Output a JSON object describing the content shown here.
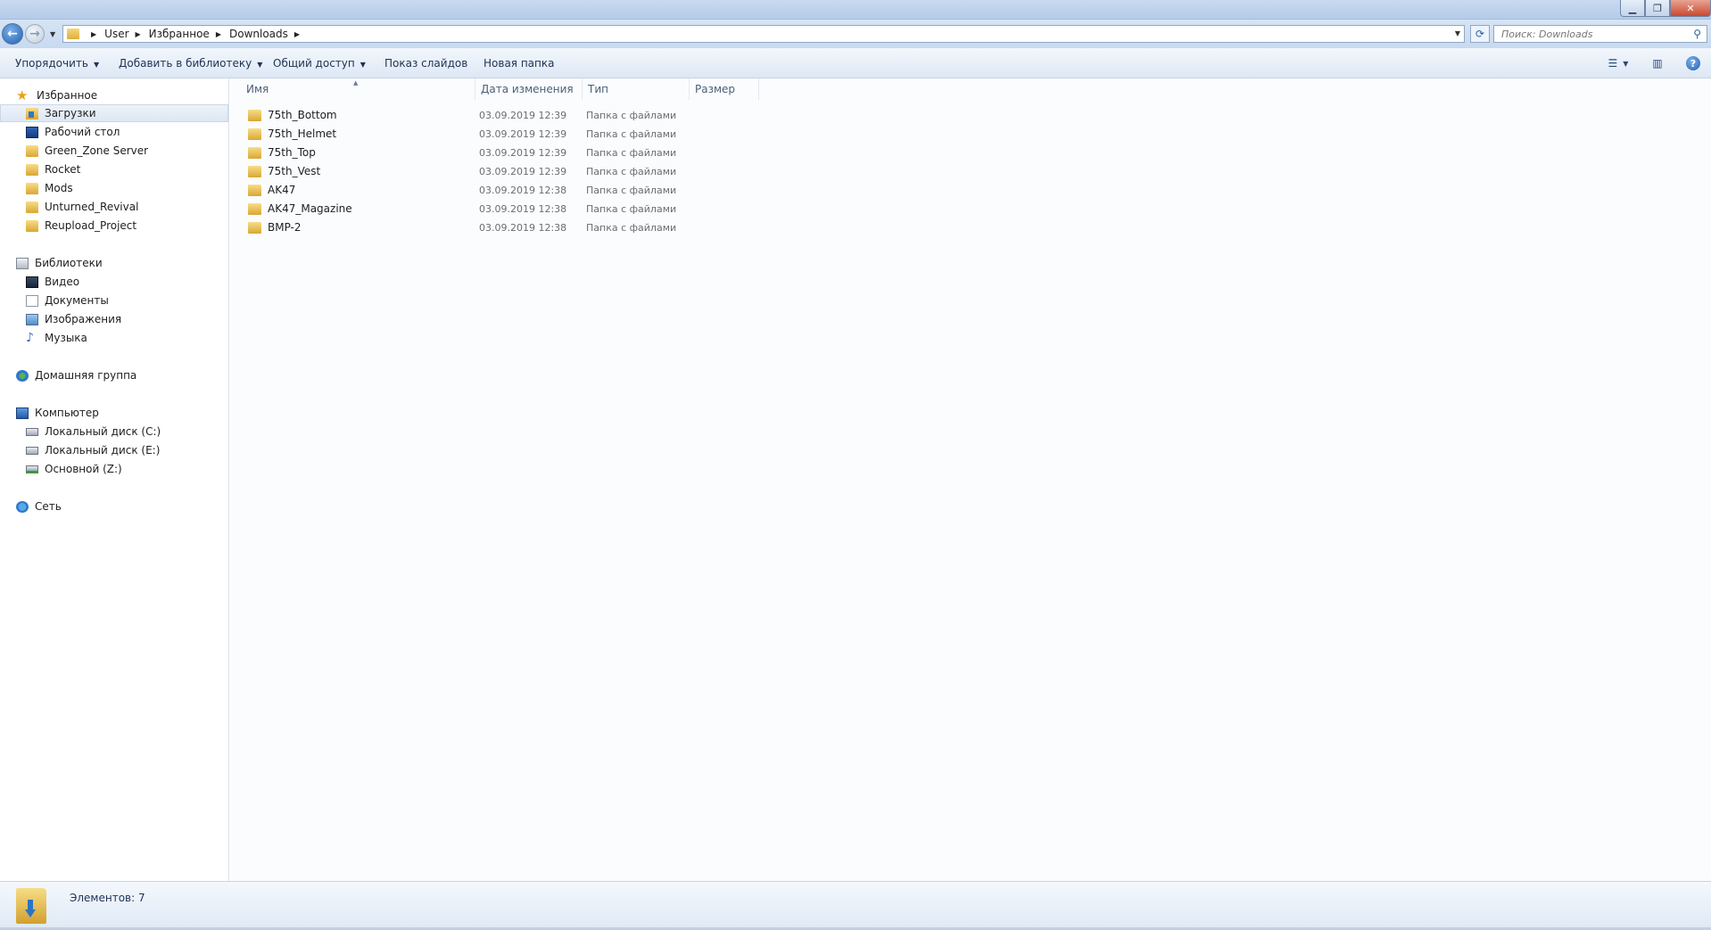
{
  "address": {
    "crumbs": [
      "User",
      "Избранное",
      "Downloads"
    ]
  },
  "search": {
    "placeholder": "Поиск: Downloads"
  },
  "toolbar": {
    "organize": "Упорядочить",
    "add_to_library": "Добавить в библиотеку",
    "share": "Общий доступ",
    "slideshow": "Показ слайдов",
    "new_folder": "Новая папка"
  },
  "nav": {
    "favorites": "Избранное",
    "favorites_items": [
      "Загрузки",
      "Рабочий стол",
      "Green_Zone Server",
      "Rocket",
      "Mods",
      "Unturned_Revival",
      "Reupload_Project"
    ],
    "libraries": "Библиотеки",
    "libraries_items": [
      "Видео",
      "Документы",
      "Изображения",
      "Музыка"
    ],
    "homegroup": "Домашняя группа",
    "computer": "Компьютер",
    "computer_items": [
      "Локальный диск (C:)",
      "Локальный диск (E:)",
      "Основной (Z:)"
    ],
    "network": "Сеть"
  },
  "columns": {
    "name": "Имя",
    "date": "Дата изменения",
    "type": "Тип",
    "size": "Размер"
  },
  "files": [
    {
      "name": "75th_Bottom",
      "date": "03.09.2019 12:39",
      "type": "Папка с файлами"
    },
    {
      "name": "75th_Helmet",
      "date": "03.09.2019 12:39",
      "type": "Папка с файлами"
    },
    {
      "name": "75th_Top",
      "date": "03.09.2019 12:39",
      "type": "Папка с файлами"
    },
    {
      "name": "75th_Vest",
      "date": "03.09.2019 12:39",
      "type": "Папка с файлами"
    },
    {
      "name": "AK47",
      "date": "03.09.2019 12:38",
      "type": "Папка с файлами"
    },
    {
      "name": "AK47_Magazine",
      "date": "03.09.2019 12:38",
      "type": "Папка с файлами"
    },
    {
      "name": "BMP-2",
      "date": "03.09.2019 12:38",
      "type": "Папка с файлами"
    }
  ],
  "status": {
    "count": "Элементов: 7"
  }
}
